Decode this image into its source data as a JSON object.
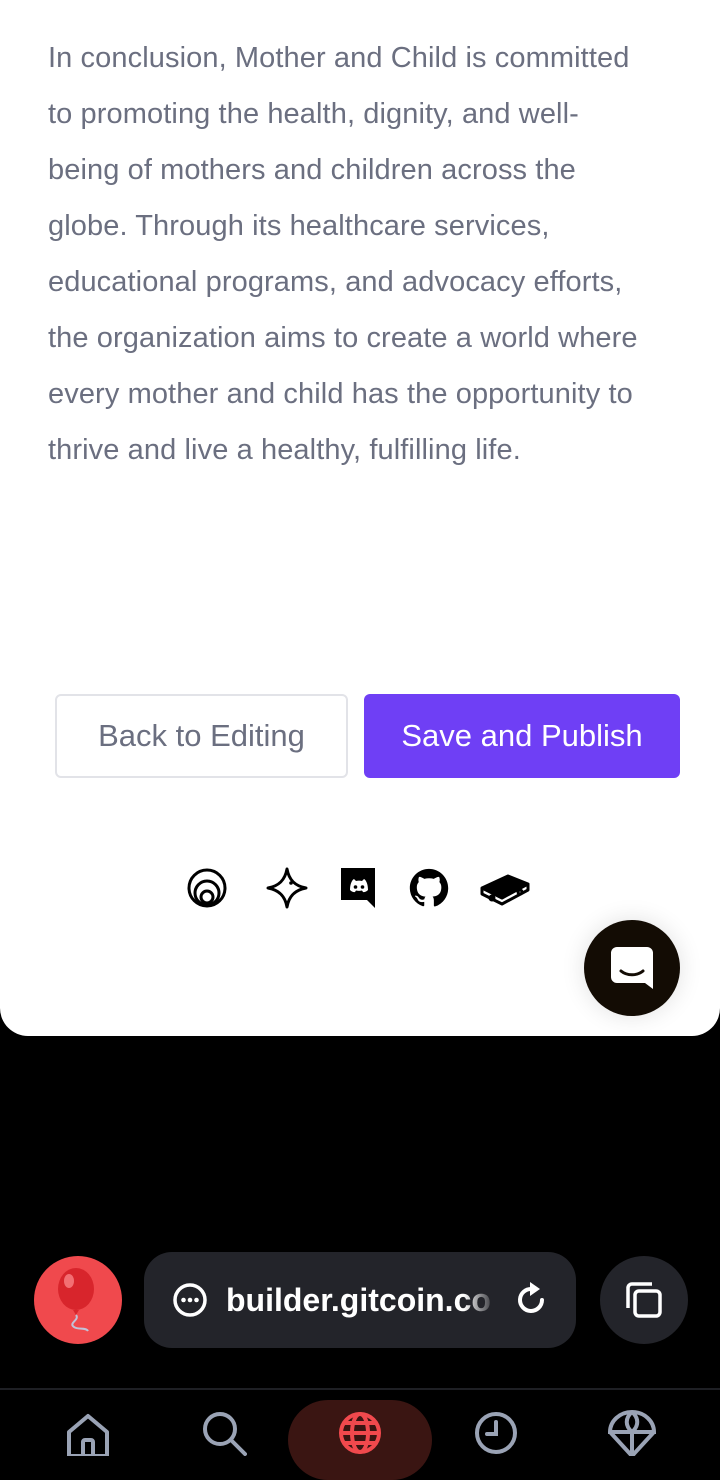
{
  "article": {
    "conclusion": "In conclusion, Mother and Child is committed to promoting the health, dignity, and well-being of mothers and children across the globe. Through its healthcare services, educational programs, and advocacy efforts, the organization aims to create a world where every mother and child has the opportunity to thrive and live a healthy, fulfilling life."
  },
  "actions": {
    "back_label": "Back to Editing",
    "save_label": "Save and Publish"
  },
  "footer": {
    "socials": [
      "gitcoin-icon",
      "sparkle-icon",
      "discord-icon",
      "github-icon",
      "docs-book-icon"
    ]
  },
  "browser": {
    "url": "builder.gitcoin.co",
    "nav_items": [
      "home-icon",
      "search-icon",
      "globe-icon",
      "history-icon",
      "parachute-icon"
    ],
    "active_nav": "globe-icon"
  },
  "colors": {
    "primary": "#6f3ff5",
    "text_muted": "#6b6f80",
    "balloon": "#f0494d",
    "active_nav": "#f0494d"
  }
}
